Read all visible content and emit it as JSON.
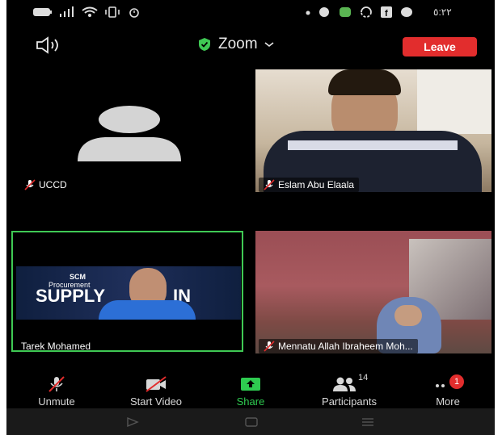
{
  "status": {
    "time": "٥:٢٢"
  },
  "header": {
    "title": "Zoom",
    "leave_label": "Leave"
  },
  "tiles": [
    {
      "name": "UCCD",
      "muted": true,
      "video": false
    },
    {
      "name": "Eslam Abu Elaala",
      "muted": true,
      "video": true
    },
    {
      "name": "Tarek Mohamed",
      "muted": false,
      "video": true,
      "active_speaker": true
    },
    {
      "name": "Mennatu Allah Ibraheem Moh...",
      "muted": true,
      "video": true
    }
  ],
  "slide": {
    "line1": "SCM",
    "line2": "Procurement",
    "big": "SUPPLY",
    "big2": "IN"
  },
  "toolbar": {
    "unmute": "Unmute",
    "start_video": "Start Video",
    "share": "Share",
    "participants": "Participants",
    "participants_count": "14",
    "more": "More",
    "more_badge": "1"
  },
  "colors": {
    "active_border": "#3fc954",
    "share_green": "#2ecb50",
    "leave_red": "#e22d2d"
  }
}
